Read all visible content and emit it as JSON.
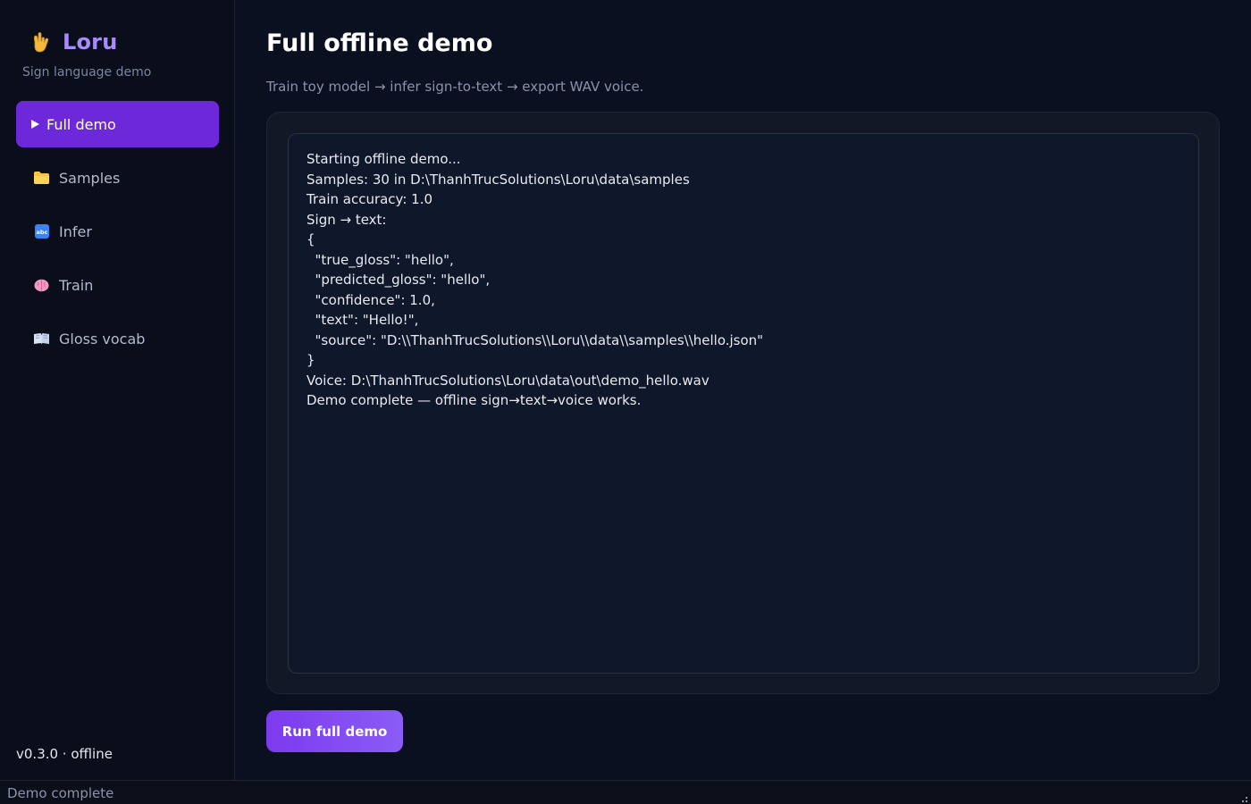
{
  "app": {
    "name": "Loru",
    "tagline": "Sign language demo",
    "version": "v0.3.0 · offline",
    "accent": "#6d28d9",
    "brand_color": "#a78bfa"
  },
  "sidebar": {
    "items": [
      {
        "label": "Full demo",
        "icon": "play-icon",
        "active": true
      },
      {
        "label": "Samples",
        "icon": "folder-icon",
        "active": false
      },
      {
        "label": "Infer",
        "icon": "abc-icon",
        "active": false
      },
      {
        "label": "Train",
        "icon": "brain-icon",
        "active": false
      },
      {
        "label": "Gloss vocab",
        "icon": "book-icon",
        "active": false
      }
    ]
  },
  "main": {
    "title": "Full offline demo",
    "subtitle": "Train toy model → infer sign-to-text → export WAV voice.",
    "log_lines": [
      "Starting offline demo...",
      "Samples: 30 in D:\\ThanhTrucSolutions\\Loru\\data\\samples",
      "Train accuracy: 1.0",
      "Sign → text:",
      "{",
      "  \"true_gloss\": \"hello\",",
      "  \"predicted_gloss\": \"hello\",",
      "  \"confidence\": 1.0,",
      "  \"text\": \"Hello!\",",
      "  \"source\": \"D:\\\\ThanhTrucSolutions\\\\Loru\\\\data\\\\samples\\\\hello.json\"",
      "}",
      "Voice: D:\\ThanhTrucSolutions\\Loru\\data\\out\\demo_hello.wav",
      "Demo complete — offline sign→text→voice works."
    ],
    "run_button": "Run full demo"
  },
  "statusbar": {
    "text": "Demo complete"
  }
}
